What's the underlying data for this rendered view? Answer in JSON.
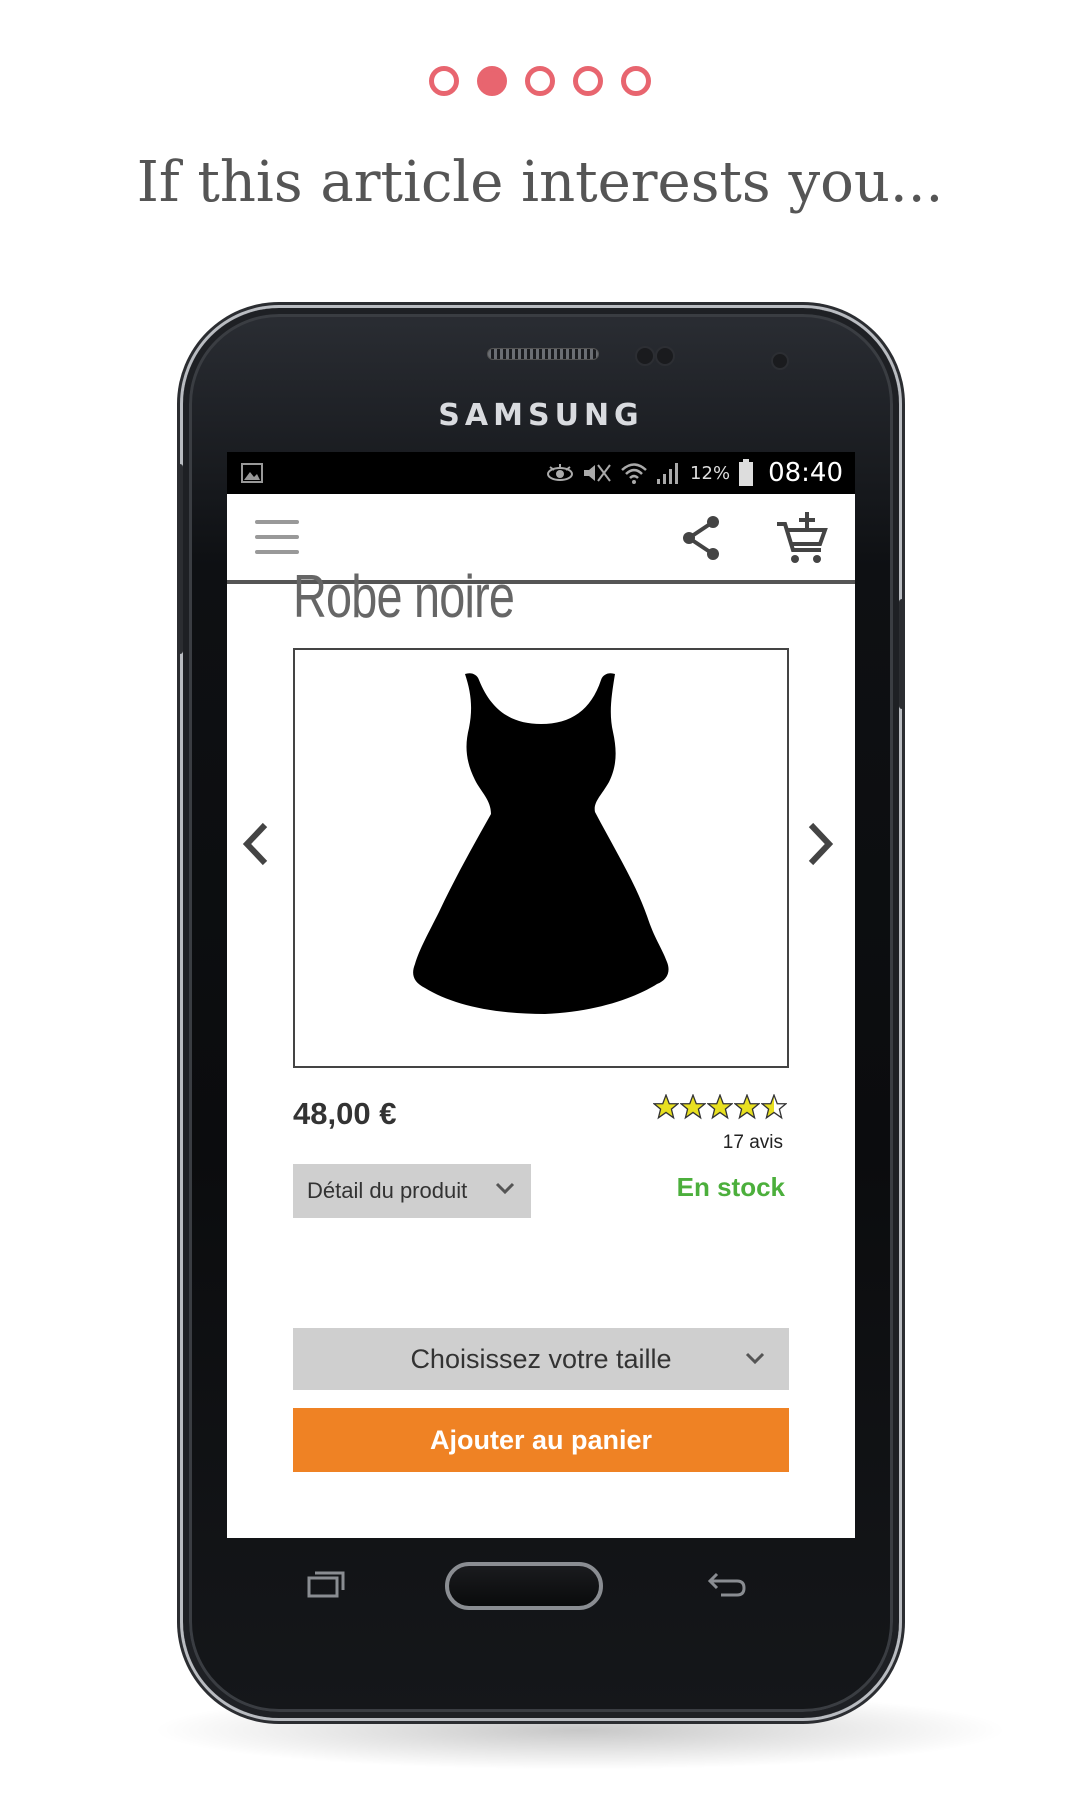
{
  "onboarding": {
    "total_dots": 5,
    "active_index": 1,
    "headline": "If this article interests you..."
  },
  "device": {
    "brand": "SAMSUNG"
  },
  "statusbar": {
    "battery": "12%",
    "time": "08:40"
  },
  "appbar": {
    "icons": [
      "menu-icon",
      "share-icon",
      "add-to-cart-icon"
    ]
  },
  "product": {
    "title": "Robe noire",
    "price": "48,00 €",
    "rating": 4.5,
    "reviews": "17 avis",
    "detail_label": "Détail du produit",
    "stock": "En stock",
    "size_placeholder": "Choisissez votre taille",
    "add_to_cart": "Ajouter au panier"
  },
  "colors": {
    "accent": "#e8656f",
    "cta": "#ef8224",
    "in_stock": "#4caf3c",
    "star": "#e8e020"
  }
}
